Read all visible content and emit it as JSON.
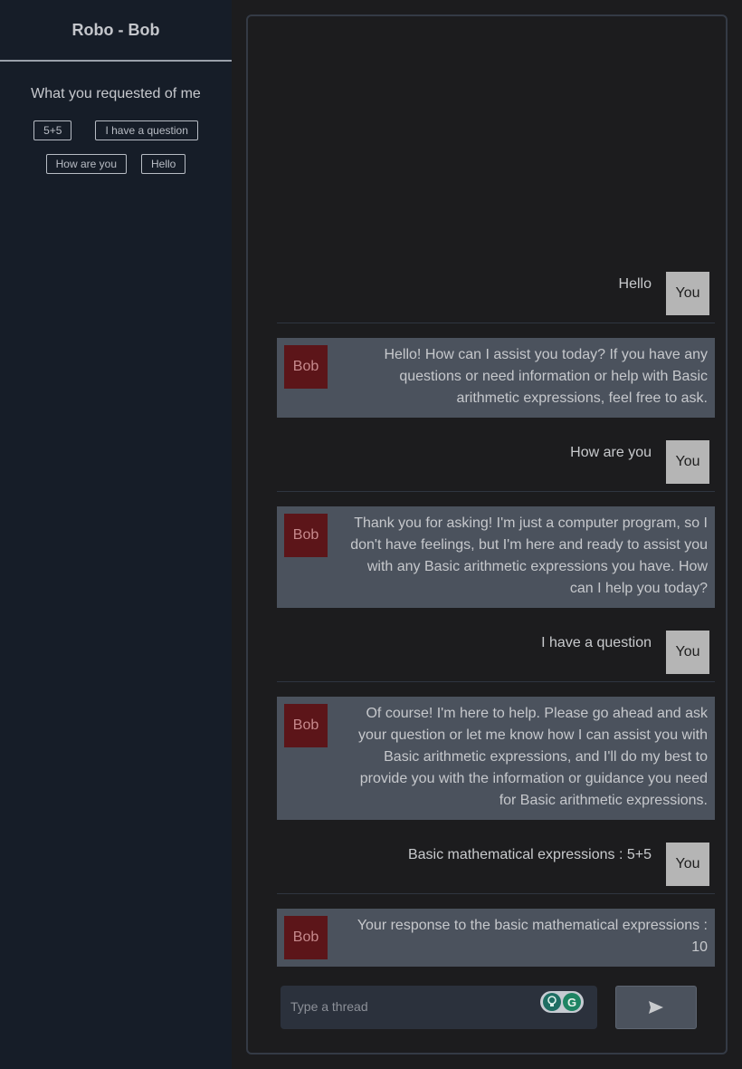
{
  "sidebar": {
    "title": "Robo - Bob",
    "subtitle": "What you requested of me",
    "chips": [
      "5+5",
      "I have a question",
      "How are you",
      "Hello"
    ]
  },
  "chat": {
    "messages": [
      {
        "sender": "You",
        "text": "Hello"
      },
      {
        "sender": "Bob",
        "text": "Hello! How can I assist you today? If you have any questions or need information or help with Basic arithmetic expressions, feel free to ask."
      },
      {
        "sender": "You",
        "text": "How are you"
      },
      {
        "sender": "Bob",
        "text": "Thank you for asking! I'm just a computer program, so I don't have feelings, but I'm here and ready to assist you with any Basic arithmetic expressions you have. How can I help you today?"
      },
      {
        "sender": "You",
        "text": "I have a question"
      },
      {
        "sender": "Bob",
        "text": "Of course! I'm here to help. Please go ahead and ask your question or let me know how I can assist you with Basic arithmetic expressions, and I'll do my best to provide you with the information or guidance you need for Basic arithmetic expressions."
      },
      {
        "sender": "You",
        "text": "Basic mathematical expressions : 5+5"
      },
      {
        "sender": "Bob",
        "text": "Your response to the basic mathematical expressions : 10"
      }
    ]
  },
  "input": {
    "placeholder": "Type a thread",
    "value": "",
    "extension_badge": "G"
  },
  "icons": {
    "send": "send-icon",
    "extension_a": "lightbulb-icon",
    "extension_b": "grammarly-icon"
  }
}
